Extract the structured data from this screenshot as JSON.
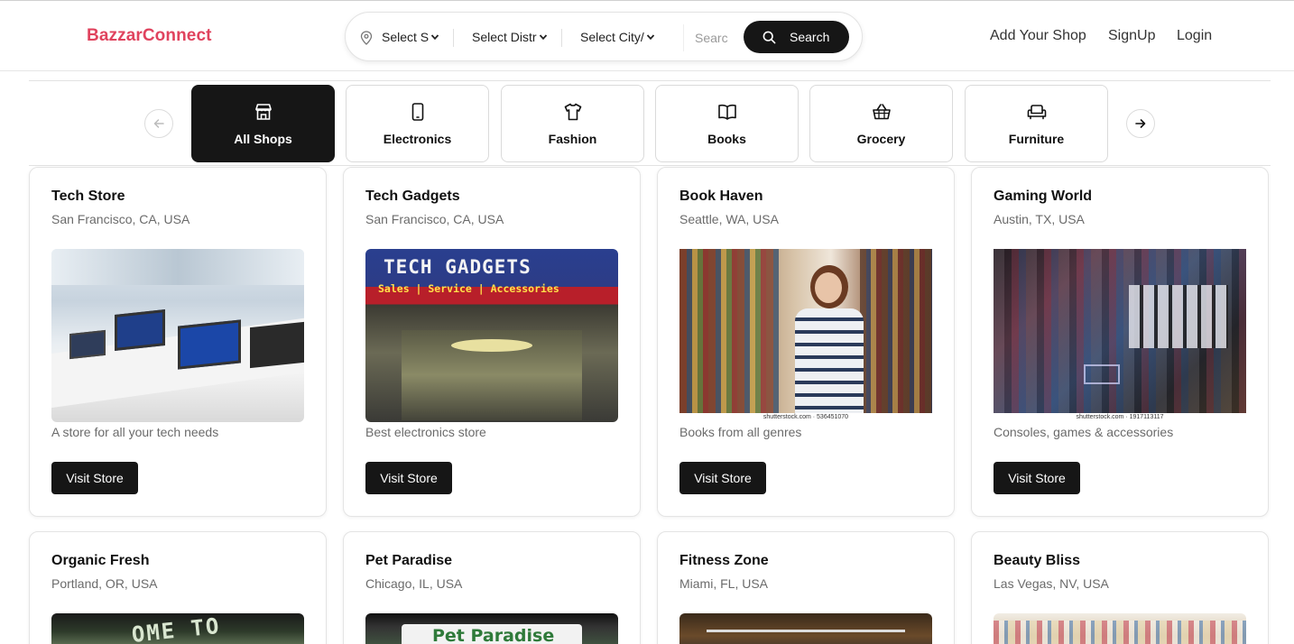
{
  "header": {
    "brand": "BazzarConnect",
    "brand_color": "#e0435e",
    "search": {
      "state_select": "Select S",
      "district_select": "Select Distr",
      "city_select": "Select City/",
      "placeholder": "Searc",
      "button_label": "Search"
    },
    "nav": [
      "Add Your Shop",
      "SignUp",
      "Login"
    ]
  },
  "categories": [
    {
      "label": "All Shops",
      "icon": "store-icon",
      "active": true
    },
    {
      "label": "Electronics",
      "icon": "phone-icon",
      "active": false
    },
    {
      "label": "Fashion",
      "icon": "shirt-icon",
      "active": false
    },
    {
      "label": "Books",
      "icon": "book-icon",
      "active": false
    },
    {
      "label": "Grocery",
      "icon": "basket-icon",
      "active": false
    },
    {
      "label": "Furniture",
      "icon": "sofa-icon",
      "active": false
    }
  ],
  "shops": [
    {
      "name": "Tech Store",
      "location": "San Francisco, CA, USA",
      "description": "A store for all your tech needs",
      "button": "Visit Store",
      "image_text": ""
    },
    {
      "name": "Tech Gadgets",
      "location": "San Francisco, CA, USA",
      "description": "Best electronics store",
      "button": "Visit Store",
      "image_text": "TECH GADGETS",
      "image_subtext": "Sales | Service | Accessories"
    },
    {
      "name": "Book Haven",
      "location": "Seattle, WA, USA",
      "description": "Books from all genres",
      "button": "Visit Store",
      "image_text": "",
      "watermark": "shutterstock.com · 536451070"
    },
    {
      "name": "Gaming World",
      "location": "Austin, TX, USA",
      "description": "Consoles, games & accessories",
      "button": "Visit Store",
      "image_text": "",
      "watermark": "shutterstock.com · 1917113117"
    },
    {
      "name": "Organic Fresh",
      "location": "Portland, OR, USA",
      "image_text": "OME TO FRESH"
    },
    {
      "name": "Pet Paradise",
      "location": "Chicago, IL, USA",
      "image_text": "Pet Paradise"
    },
    {
      "name": "Fitness Zone",
      "location": "Miami, FL, USA"
    },
    {
      "name": "Beauty Bliss",
      "location": "Las Vegas, NV, USA"
    }
  ]
}
